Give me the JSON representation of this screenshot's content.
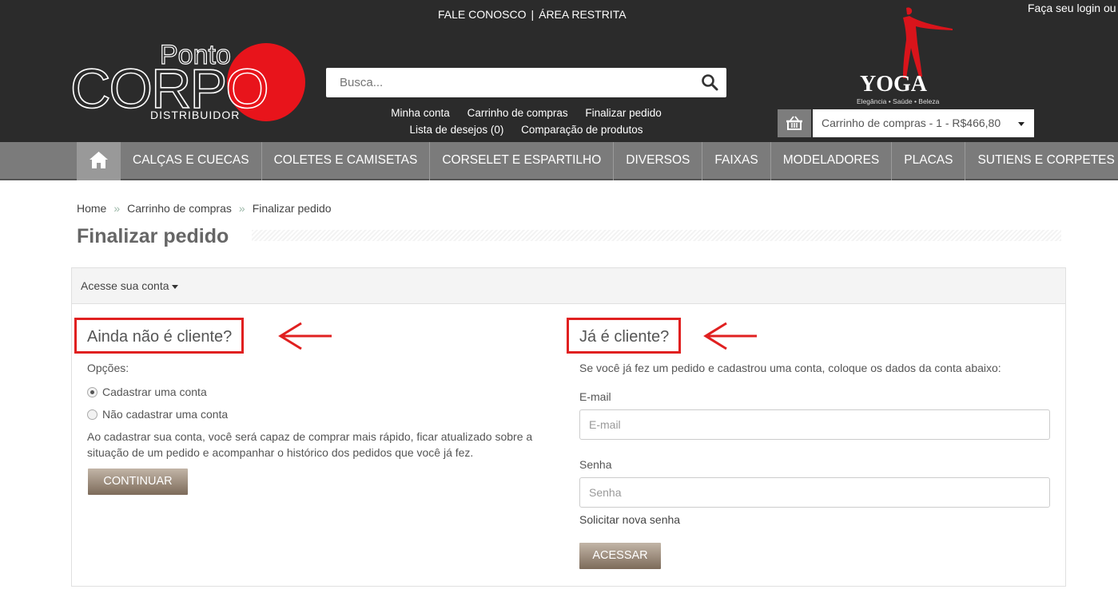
{
  "header": {
    "top_links": [
      "FALE CONOSCO",
      "ÁREA RESTRITA"
    ],
    "top_separator": "|",
    "login_text": "Faça seu login ou",
    "logo": {
      "ponto": "Ponto",
      "corpo": "CORPO",
      "distribuidor": "DISTRIBUIDOR"
    },
    "search": {
      "placeholder": "Busca..."
    },
    "links_row1": [
      "Minha conta",
      "Carrinho de compras",
      "Finalizar pedido"
    ],
    "links_row2": [
      "Lista de desejos (0)",
      "Comparação de produtos"
    ],
    "brand_logo": {
      "name": "YOGA",
      "tagline": "Elegância • Saúde • Beleza"
    },
    "cart": {
      "label": "Carrinho de compras - 1 - R$466,80"
    }
  },
  "nav": {
    "items": [
      "CALÇAS E CUECAS",
      "COLETES E CAMISETAS",
      "CORSELET E ESPARTILHO",
      "DIVERSOS",
      "FAIXAS",
      "MODELADORES",
      "PLACAS",
      "SUTIENS E CORPETES"
    ]
  },
  "breadcrumb": [
    "Home",
    "Carrinho de compras",
    "Finalizar pedido"
  ],
  "breadcrumb_separator": "»",
  "page_title": "Finalizar pedido",
  "panel": {
    "heading": "Acesse sua conta",
    "new_customer": {
      "title": "Ainda não é cliente?",
      "options_label": "Opções:",
      "option_register": "Cadastrar uma conta",
      "option_guest": "Não cadastrar uma conta",
      "description": "Ao cadastrar sua conta, você será capaz de comprar mais rápido, ficar atualizado sobre a situação de um pedido e acompanhar o histórico dos pedidos que você já fez.",
      "continue_label": "CONTINUAR"
    },
    "returning_customer": {
      "title": "Já é cliente?",
      "description": "Se você já fez um pedido e cadastrou uma conta, coloque os dados da conta abaixo:",
      "email_label": "E-mail",
      "email_placeholder": "E-mail",
      "password_label": "Senha",
      "password_placeholder": "Senha",
      "forgot_link": "Solicitar nova senha",
      "login_label": "ACESSAR"
    }
  },
  "colors": {
    "header_bg": "#2b2b2b",
    "nav_bg": "#7b7b7b",
    "logo_red": "#e8141b",
    "highlight": "#e02020",
    "button": "#9c8a78"
  }
}
